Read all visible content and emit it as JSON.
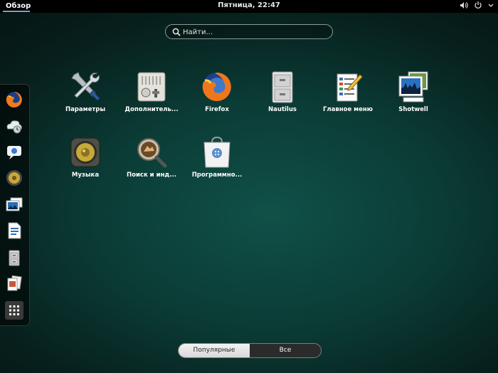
{
  "topbar": {
    "activities": "Обзор",
    "clock": "Пятница, 22:47",
    "tray": {
      "volume_icon": "volume-icon",
      "power_icon": "power-icon",
      "chevron_icon": "chevron-down-icon"
    }
  },
  "search": {
    "placeholder": "Найти..."
  },
  "dash": {
    "items": [
      {
        "icon": "firefox-icon"
      },
      {
        "icon": "backup-icon"
      },
      {
        "icon": "empathy-icon"
      },
      {
        "icon": "rhythmbox-icon"
      },
      {
        "icon": "shotwell-icon"
      },
      {
        "icon": "writer-icon"
      },
      {
        "icon": "nautilus-icon"
      },
      {
        "icon": "documents-icon"
      },
      {
        "icon": "show-apps-icon"
      }
    ]
  },
  "apps": [
    {
      "label": "Параметры",
      "icon": "settings-icon"
    },
    {
      "label": "Дополнитель...",
      "icon": "tweak-tool-icon"
    },
    {
      "label": "Firefox",
      "icon": "firefox-icon"
    },
    {
      "label": "Nautilus",
      "icon": "file-cabinet-icon"
    },
    {
      "label": "Главное меню",
      "icon": "menu-editor-icon"
    },
    {
      "label": "Shotwell",
      "icon": "shotwell-icon"
    },
    {
      "label": "Музыка",
      "icon": "speaker-icon"
    },
    {
      "label": "Поиск и инд...",
      "icon": "magnifier-icon"
    },
    {
      "label": "Программно...",
      "icon": "shopping-bag-icon"
    }
  ],
  "view_switch": {
    "frequent": "Популярные",
    "all": "Все"
  }
}
